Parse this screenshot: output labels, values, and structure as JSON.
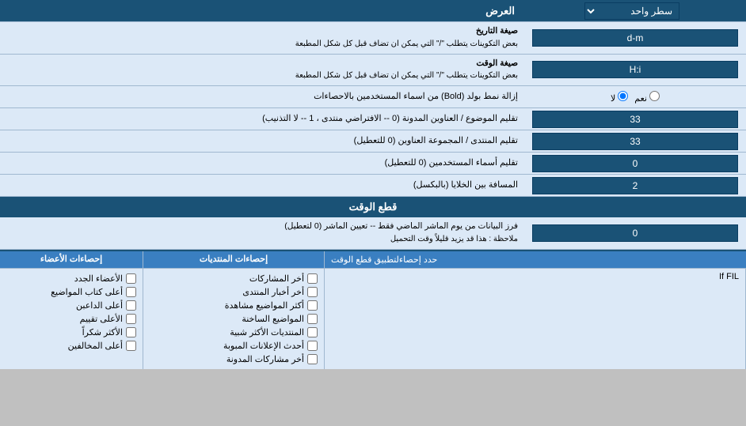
{
  "header": {
    "title": "العرض",
    "dropdown_label": "سطر واحد"
  },
  "rows": [
    {
      "label": "صيغة التاريخ",
      "sublabel": "بعض التكوينات يتطلب \"/\" التي يمكن ان تضاف قبل كل شكل المطبعة",
      "value": "d-m",
      "type": "input"
    },
    {
      "label": "صيغة الوقت",
      "sublabel": "بعض التكوينات يتطلب \"/\" التي يمكن ان تضاف قبل كل شكل المطبعة",
      "value": "H:i",
      "type": "input"
    },
    {
      "label": "إزالة نمط بولد (Bold) من اسماء المستخدمين بالاحصاءات",
      "value": "",
      "type": "radio",
      "radio_yes": "نعم",
      "radio_no": "لا",
      "selected": "no"
    },
    {
      "label": "تقليم الموضوع / العناوين المدونة (0 -- الافتراضي منتدى ، 1 -- لا التذنيب)",
      "value": "33",
      "type": "input"
    },
    {
      "label": "تقليم المنتدى / المجموعة العناوين (0 للتعطيل)",
      "value": "33",
      "type": "input"
    },
    {
      "label": "تقليم أسماء المستخدمين (0 للتعطيل)",
      "value": "0",
      "type": "input"
    },
    {
      "label": "المسافة بين الخلايا (بالبكسل)",
      "value": "2",
      "type": "input"
    }
  ],
  "time_section": {
    "header": "قطع الوقت",
    "row_label": "فرز البيانات من يوم الماشر الماضي فقط -- تعيين الماشر (0 لتعطيل)",
    "row_note": "ملاحظة : هذا قد يزيد قليلاً وقت التحميل",
    "row_value": "0"
  },
  "stats_section": {
    "limit_label": "حدد إحصاءلتطبيق قطع الوقت",
    "col1_header": "إحصاءات المنتديات",
    "col2_header": "إحصاءات الأعضاء",
    "col1_items": [
      "أخر المشاركات",
      "أخر أخبار المنتدى",
      "أكثر المواضيع مشاهدة",
      "المواضيع الساخنة",
      "المنتديات الأكثر شبية",
      "أحدث الإعلانات المبوبة",
      "أخر مشاركات المدونة"
    ],
    "col2_items": [
      "الأعضاء الجدد",
      "أعلى كتاب المواضيع",
      "أعلى الداعبن",
      "الأعلى تقييم",
      "الأكثر شكراً",
      "أعلى المخالفين"
    ]
  },
  "bottom_label": "If FIL"
}
